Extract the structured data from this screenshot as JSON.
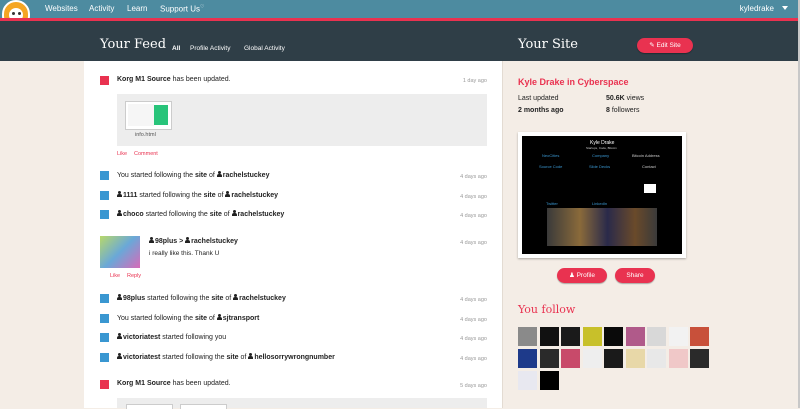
{
  "colors": {
    "accent": "#e93250",
    "nav": "#4d8ba0",
    "header": "#2f3e47",
    "event_blue": "#3a97d1"
  },
  "nav": {
    "logo_icon": "cat-logo-icon",
    "links": [
      "Websites",
      "Activity",
      "Learn",
      "Support Us"
    ],
    "support_sup": "♡",
    "user": "kyledrake"
  },
  "feed": {
    "title": "Your Feed",
    "tabs": [
      "All",
      "Profile Activity",
      "Global Activity"
    ],
    "events": [
      {
        "who": "Korg M1 Source",
        "text": " has been updated.",
        "time": "1 day ago"
      },
      {
        "you": "You",
        "mid1": " started following the ",
        "site": "site",
        "mid2": " of ",
        "target": "rachelstuckey",
        "time": "4 days ago"
      },
      {
        "who": "1111",
        "mid1": " started following the ",
        "site": "site",
        "mid2": " of ",
        "target": "rachelstuckey",
        "time": "4 days ago"
      },
      {
        "who": "choco",
        "mid1": " started following the ",
        "site": "site",
        "mid2": " of ",
        "target": "rachelstuckey",
        "time": "4 days ago"
      },
      {
        "who": "98plus",
        "sep": " > ",
        "target": "rachelstuckey",
        "message": "i really like this. Thank U",
        "time": "4 days ago"
      },
      {
        "who": "98plus",
        "mid1": " started following the ",
        "site": "site",
        "mid2": " of ",
        "target": "rachelstuckey",
        "time": "4 days ago"
      },
      {
        "you": "You",
        "mid1": " started following the ",
        "site": "site",
        "mid2": " of ",
        "target": "sjtransport",
        "time": "4 days ago"
      },
      {
        "who": "victoriatest",
        "mid1": " started following you",
        "time": "4 days ago"
      },
      {
        "who": "victoriatest",
        "mid1": " started following the ",
        "site": "site",
        "mid2": " of ",
        "target": "hellosorrywrongnumber",
        "time": "4 days ago"
      },
      {
        "who": "Korg M1 Source",
        "text": " has been updated.",
        "time": "5 days ago"
      }
    ],
    "update_file": "info.html",
    "like": "Like",
    "comment": "Comment",
    "reply": "Reply"
  },
  "site": {
    "title": "Your Site",
    "edit_button": "Edit Site",
    "name": "Kyle Drake in Cyberspace",
    "last_updated_label": "Last updated",
    "last_updated_value": "2 months ago",
    "views_value": "50.6K",
    "views_label": "views",
    "followers_value": "8",
    "followers_label": "followers",
    "profile_button": "Profile",
    "share_button": "Share",
    "screenshot": {
      "heading": "Kyle Drake",
      "subheading": "Startups, Code, Bitcoin",
      "links": [
        "NeoCities",
        "Company",
        "Source Code",
        "Slide Decks",
        "Twitter",
        "LinkedIn"
      ],
      "bitcoin": "Bitcoin Address",
      "contact": "Contact"
    },
    "you_follow_title": "You follow",
    "follow_colors": [
      "#8a8a8a",
      "#111111",
      "#1a1a1a",
      "#c8c02a",
      "#0a0a0a",
      "#b05a8a",
      "#d8d8d8",
      "#f2f2f2",
      "#c8503a",
      "#1e3a8a",
      "#2a2a2a",
      "#c84a6a",
      "#eeeeee",
      "#1a1a1a",
      "#e8d8a8",
      "#e8e8e8",
      "#f0c8c8",
      "#2a2a2a",
      "#e8e8f0",
      "#000000"
    ]
  }
}
